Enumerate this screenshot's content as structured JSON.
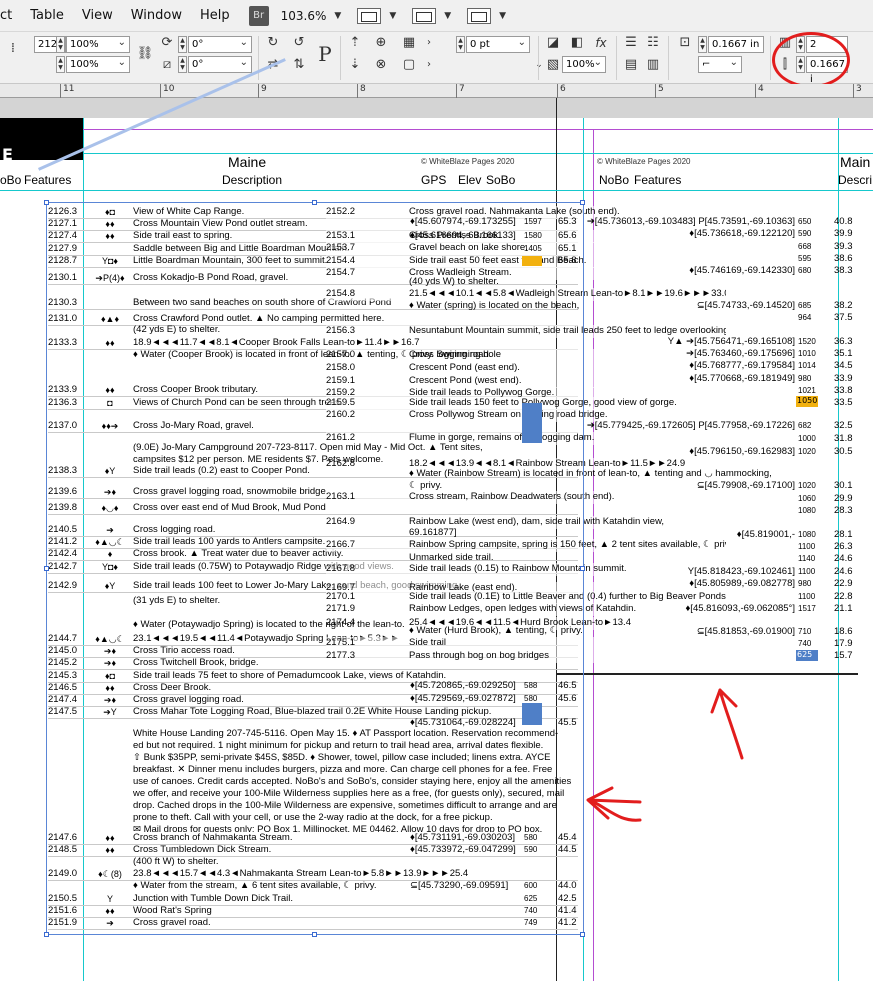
{
  "menu": {
    "items": [
      "ct",
      "Table",
      "View",
      "Window",
      "Help"
    ],
    "bridge_label": "Br",
    "zoom": "103.6%"
  },
  "control": {
    "ref_x": "2126",
    "scale_x": "100%",
    "scale_y": "100%",
    "rotate": "0°",
    "shear": "0°",
    "stroke_weight": "0 pt",
    "opacity": "100%",
    "width_val": "0.1667 in",
    "columns": "2",
    "gutter": "0.1667 i"
  },
  "ruler": {
    "ticks": [
      "11",
      "10",
      "9",
      "8",
      "7",
      "6",
      "5",
      "4",
      "3"
    ]
  },
  "page": {
    "tab_letter": "E",
    "left_title": "Maine",
    "left_header_nobo": "oBo",
    "left_header_features": "Features",
    "left_header_description": "Description",
    "left_header_gps": "GPS",
    "left_header_elev": "Elev",
    "left_header_sobo": "SoBo",
    "copyright": "© WhiteBlaze Pages 2020",
    "right_title": "Main",
    "right_header_nobo": "NoBo",
    "right_header_features": "Features",
    "right_header_desc": "Descri"
  },
  "left_rows": [
    {
      "mile": "2126.3",
      "sym": "♦◘",
      "desc": "View of White Cap Range."
    },
    {
      "mile": "2127.1",
      "sym": "♦♦",
      "desc": "Cross Mountain View Pond outlet stream."
    },
    {
      "mile": "2127.4",
      "sym": "♦♦",
      "desc": "Side trail east to spring."
    },
    {
      "mile": "2127.9",
      "sym": "",
      "desc": "Saddle between Big and Little Boardman Mountain."
    },
    {
      "mile": "2128.7",
      "sym": "Y◘♦",
      "desc": "Little Boardman Mountain, 300 feet to summit."
    },
    {
      "mile": "2130.1",
      "sym": "➔P(4)♦",
      "desc": "Cross Kokadjo-B Pond Road, gravel."
    },
    {
      "mile": "2130.3",
      "sym": "",
      "desc": "Between two sand beaches on south shore of Crawford Pond"
    },
    {
      "mile": "2131.0",
      "sym": "♦▲♦",
      "desc": "Cross Crawford Pond outlet. ▲ No camping permitted here."
    },
    {
      "mile": "2133.3",
      "sym": "♦♦",
      "desc": "18.9◄◄◄11.7◄◄8.1◄Cooper Brook Falls Lean-to►11.4►►16.7"
    },
    {
      "mile": "2133.9",
      "sym": "♦♦",
      "desc": "Cross Cooper Brook tributary."
    },
    {
      "mile": "2136.3",
      "sym": "◘",
      "desc": "Views of Church Pond can be seen through trees."
    },
    {
      "mile": "2137.0",
      "sym": "♦♦➔",
      "desc": "Cross Jo-Mary Road, gravel."
    },
    {
      "mile": "2138.3",
      "sym": "♦Y",
      "desc": "Side trail leads (0.2) east to Cooper Pond."
    },
    {
      "mile": "2139.6",
      "sym": "➔♦",
      "desc": "Cross gravel logging road, snowmobile bridge."
    },
    {
      "mile": "2139.8",
      "sym": "♦◡♦",
      "desc": "Cross over east end of Mud Brook, Mud Pond"
    },
    {
      "mile": "2140.5",
      "sym": "➔",
      "desc": "Cross logging road."
    },
    {
      "mile": "2141.2",
      "sym": "♦▲◡☾",
      "desc": "Side trail leads 100 yards to Antlers campsite."
    },
    {
      "mile": "2142.4",
      "sym": "♦",
      "desc": "Cross brook. ▲ Treat water due to beaver activity."
    },
    {
      "mile": "2142.7",
      "sym": "Y◘♦",
      "desc": "Side trail leads (0.75W) to Potaywadjo Ridge with good views."
    },
    {
      "mile": "2142.9",
      "sym": "♦Y",
      "desc": "Side trail leads 100 feet to Lower Jo-Mary Lake, sand beach, good swimming."
    },
    {
      "mile": "2144.7",
      "sym": "♦▲◡☾",
      "desc": "23.1◄◄◄19.5◄◄11.4◄Potaywadjo Spring Lean-to►5.3►►"
    },
    {
      "mile": "2145.0",
      "sym": "➔♦",
      "desc": "Cross Tirio access road."
    },
    {
      "mile": "2145.2",
      "sym": "➔♦",
      "desc": "Cross Twitchell Brook, bridge."
    },
    {
      "mile": "2145.3",
      "sym": "♦◘",
      "desc": "Side trail leads 75 feet to shore of Pemadumcook Lake, views of Katahdin."
    },
    {
      "mile": "2146.5",
      "sym": "♦♦",
      "desc": "Cross Deer Brook."
    },
    {
      "mile": "2147.4",
      "sym": "➔♦",
      "desc": "Cross gravel logging road."
    },
    {
      "mile": "2147.5",
      "sym": "➔Y",
      "desc": "Cross Mahar Tote Logging Road, Blue-blazed trail 0.2E White House Landing pickup."
    },
    {
      "mile": "2147.6",
      "sym": "♦♦",
      "desc": "Cross branch of Nahmakanta Stream."
    },
    {
      "mile": "2148.5",
      "sym": "♦♦",
      "desc": "Cross Tumbledown Dick Stream."
    },
    {
      "mile": "2149.0",
      "sym": "♦☾(8)",
      "desc": "23.8◄◄◄15.7◄◄4.3◄Nahmakanta Stream Lean-to►5.8►►13.9►►►25.4"
    },
    {
      "mile": "2150.5",
      "sym": "Y",
      "desc": "Junction with Tumble Down Dick Trail."
    },
    {
      "mile": "2151.6",
      "sym": "♦♦",
      "desc": "Wood Rat's Spring"
    },
    {
      "mile": "2151.9",
      "sym": "➔",
      "desc": "Cross gravel road."
    }
  ],
  "white_house": "White House Landing 207-745-5116. Open May 15. ♦ AT Passport location. Reservation recommend-\ned but not required. 1 night minimum for pickup and return to trail head area, arrival dates flexible.\n⇧ Bunk $35PP, semi-private $45S, $85D. ♦ Shower, towel, pillow case included; linens extra. AYCE\nbreakfast. ✕ Dinner menu includes burgers, pizza and more. Can charge cell phones for a fee. Free\nuse of canoes. Credit cards accepted. NoBo's and SoBo's, consider staying here, enjoy all the amenities\nwe offer, and receive your 100-Mile Wilderness supplies here as a free, (for guests only), secured, mail\ndrop. Cached drops in the 100-Mile Wilderness are expensive, sometimes difficult to arrange and are\nprone to theft. Call with your cell, or use the 2-way radio at the dock, for a free pickup.\n✉ Mail drops for guests only: PO Box 1, Millinocket, ME 04462. Allow 10 days for drop to PO box.",
  "cooper_note": "(42 yds E) to shelter.",
  "cooper_water": "♦ Water (Cooper Brook) is located in front of lean-to. ▲ tenting, ☾ privy. Swimming hole",
  "jomary_desc": "(9.0E) Jo-Mary Campground 207-723-8117. Open mid May - Mid Oct. ▲ Tent sites,",
  "jomary_desc2": "campsites $12 per person. ME residents $7. Pets welcome.",
  "potay_note": "(31 yds E) to shelter.",
  "potay_water": "♦ Water (Potaywadjo Spring) is located to the right of the lean-to.",
  "nahm_note": "(400 ft W) to shelter.",
  "nahm_water": "♦ Water from the stream, ▲ 6 tent sites available, ☾ privy.",
  "mid_rows": [
    {
      "mile": "2152.2",
      "desc": "Cross gravel road. Nahmakanta Lake (south end)."
    },
    {
      "mile": "2153.1",
      "desc": "Cross Prentiss Brook."
    },
    {
      "mile": "2153.7",
      "desc": "Gravel beach on lake shore."
    },
    {
      "mile": "2154.4",
      "desc": "Side trail east 50 feet east to Sand Beach."
    },
    {
      "mile": "2154.7",
      "desc": "Cross Wadleigh Stream."
    },
    {
      "mile": "2154.8",
      "desc": "21.5◄◄◄10.1◄◄5.8◄Wadleigh Stream Lean-to►8.1►►19.6►►►33.0"
    },
    {
      "mile": "2156.3",
      "desc": "Nesuntabunt Mountain summit, side trail leads 250 feet to ledge overlooking Nesunt-"
    },
    {
      "mile": "2157.0",
      "desc": "Cross logging road."
    },
    {
      "mile": "2158.0",
      "desc": "Crescent Pond (east end)."
    },
    {
      "mile": "2159.1",
      "desc": "Crescent Pond (west end)."
    },
    {
      "mile": "2159.2",
      "desc": "Side trail leads to Pollywog Gorge."
    },
    {
      "mile": "2159.5",
      "desc": "Side trail leads 150 feet to Pollywog Gorge, good view of gorge."
    },
    {
      "mile": "2160.2",
      "desc": "Cross Pollywog Stream on logging road bridge."
    },
    {
      "mile": "2161.2",
      "desc": "Flume in gorge, remains of old logging dam."
    },
    {
      "mile": "2162.8",
      "desc": "18.2◄◄◄13.9◄◄8.1◄Rainbow Stream Lean-to►11.5►►24.9"
    },
    {
      "mile": "2163.1",
      "desc": "Cross stream, Rainbow Deadwaters (south end)."
    },
    {
      "mile": "2164.9",
      "desc": "Rainbow Lake (west end), dam, side trail with Katahdin view,"
    },
    {
      "mile": "2166.7",
      "desc": "Rainbow Spring campsite, spring is 150 feet, ▲ 2 tent sites available, ☾ privy."
    },
    {
      "mile": "2167.8",
      "desc": "Side trail leads (0.15) to Rainbow Mountain summit."
    },
    {
      "mile": "2169.7",
      "desc": "Rainbow Lake (east end)."
    },
    {
      "mile": "2170.1",
      "desc": "Side trail leads (0.1E) to Little Beaver and (0.4) further to Big Beaver Ponds."
    },
    {
      "mile": "2171.9",
      "desc": "Rainbow Ledges, open ledges with views of Katahdin."
    },
    {
      "mile": "2174.4",
      "desc": "25.4◄◄◄19.6◄◄11.5◄Hurd Brook Lean-to►13.4"
    },
    {
      "mile": "2175.1",
      "desc": "Side trail"
    },
    {
      "mile": "2177.3",
      "desc": "Pass through bog on bog bridges"
    }
  ],
  "gps": [
    {
      "coord": "♦[45.607974,-69.173255]",
      "elev": "1597",
      "sobo": "65.3"
    },
    {
      "coord": "♦[45.616694,-69.166133]",
      "elev": "1580",
      "sobo": "65.6"
    },
    {
      "coord": "",
      "elev": "1405",
      "sobo": "65.1"
    },
    {
      "coord": "",
      "elev": "1405",
      "sobo": "65.8"
    },
    {
      "coord": "♦[45.720865,-69.029250]",
      "elev": "588",
      "sobo": "46.5"
    },
    {
      "coord": "♦[45.729569,-69.027872]",
      "elev": "580",
      "sobo": "45.6"
    },
    {
      "coord": "♦[45.731064,-69.028224]",
      "elev": "580",
      "sobo": "45.5"
    },
    {
      "coord": "♦[45.731191,-69.030203]",
      "elev": "580",
      "sobo": "45.4"
    },
    {
      "coord": "♦[45.733972,-69.047299]",
      "elev": "590",
      "sobo": "44.5"
    },
    {
      "coord": "⊆[45.73290,-69.09591]",
      "elev": "600",
      "sobo": "44.0"
    },
    {
      "coord": "",
      "elev": "625",
      "sobo": "42.5"
    },
    {
      "coord": "",
      "elev": "740",
      "sobo": "41.4"
    },
    {
      "coord": "",
      "elev": "749",
      "sobo": "41.2"
    }
  ],
  "right_rows": [
    {
      "coord": "➔[45.736013,-69.103483] P[45.73591,-69.10363]",
      "elev": "650",
      "sobo": "40.8"
    },
    {
      "coord": "♦[45.736618,-69.122120]",
      "elev": "590",
      "sobo": "39.9"
    },
    {
      "coord": "",
      "elev": "668",
      "sobo": "39.3"
    },
    {
      "coord": "",
      "elev": "595",
      "sobo": "38.6"
    },
    {
      "coord": "♦[45.746169,-69.142330]",
      "elev": "680",
      "sobo": "38.3"
    },
    {
      "coord": "⊆[45.74733,-69.14520]",
      "elev": "685",
      "sobo": "38.2"
    },
    {
      "coord": "",
      "elev": "964",
      "sobo": "37.5"
    },
    {
      "coord": "Y▲ ➔[45.756471,-69.165108]",
      "elev": "1520",
      "sobo": "36.3"
    },
    {
      "coord": "➔[45.763460,-69.175696]",
      "elev": "1010",
      "sobo": "35.1"
    },
    {
      "coord": "♦[45.768777,-69.179584]",
      "elev": "1014",
      "sobo": "34.5"
    },
    {
      "coord": "♦[45.770668,-69.181949]",
      "elev": "980",
      "sobo": "33.9"
    },
    {
      "coord": "",
      "elev": "1021",
      "sobo": "33.8"
    },
    {
      "coord": "",
      "elev": "1050",
      "sobo": "33.5"
    },
    {
      "coord": "➔[45.779425,-69.172605] P[45.77958,-69.17226]",
      "elev": "682",
      "sobo": "32.5"
    },
    {
      "coord": "",
      "elev": "1000",
      "sobo": "31.8"
    },
    {
      "coord": "♦[45.796150,-69.162983]",
      "elev": "1020",
      "sobo": "30.5"
    },
    {
      "coord": "⊆[45.79908,-69.17100]",
      "elev": "1020",
      "sobo": "30.1"
    },
    {
      "coord": "",
      "elev": "1060",
      "sobo": "29.9"
    },
    {
      "coord": "",
      "elev": "1080",
      "sobo": "28.3"
    },
    {
      "coord": "♦[45.819001,-",
      "elev": "1080",
      "sobo": "28.1"
    },
    {
      "coord": "",
      "elev": "1100",
      "sobo": "26.3"
    },
    {
      "coord": "",
      "elev": "1140",
      "sobo": "24.6"
    },
    {
      "coord": "Y[45.818423,-69.102461]",
      "elev": "1100",
      "sobo": "24.6"
    },
    {
      "coord": "♦[45.805989,-69.082778]",
      "elev": "980",
      "sobo": "22.9"
    },
    {
      "coord": "",
      "elev": "1100",
      "sobo": "22.8"
    },
    {
      "coord": "♦[45.816093,-69.062085°]",
      "elev": "1517",
      "sobo": "21.1"
    },
    {
      "coord": "⊆[45.81853,-69.01900]",
      "elev": "710",
      "sobo": "18.6"
    },
    {
      "coord": "",
      "elev": "740",
      "sobo": "17.9"
    },
    {
      "coord": "",
      "elev": "625",
      "sobo": "15.7"
    }
  ],
  "extra_mid": [
    {
      "text": "(40 yds W) to shelter."
    },
    {
      "text": "♦ Water (spring) is located on the beach, ▲ tenting, ☾ privy."
    },
    {
      "text": "♦ Water (Rainbow Stream) is located in front of lean-to, ▲ tenting and ◡ hammocking,"
    },
    {
      "text": "☾ privy."
    },
    {
      "text": "♦ Water (Hurd Brook), ▲ tenting, ☾ privy."
    },
    {
      "text": "Unmarked side trail."
    },
    {
      "text": "69.161877]"
    }
  ],
  "colors": {
    "guide_cyan": "#16c8cc",
    "guide_magenta": "#b44dd1",
    "annotation_red": "#e21d1d",
    "elev_blue": "#4f7fc7",
    "elev_orange": "#f2b10f"
  }
}
